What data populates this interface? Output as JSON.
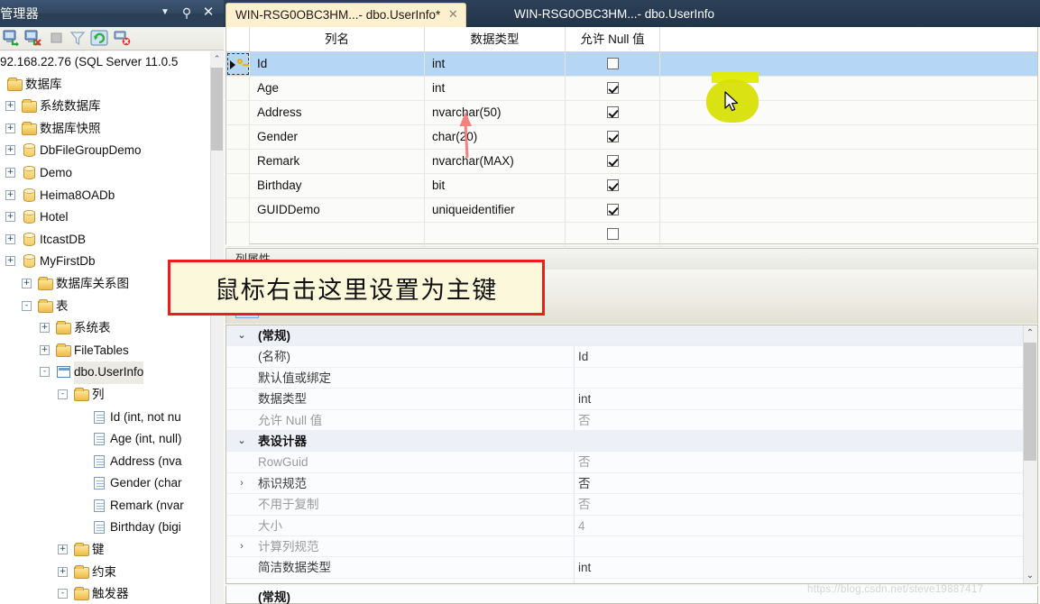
{
  "object_explorer": {
    "title": "源管理器",
    "window_buttons": {
      "dropdown": "▼",
      "pin": "⚲",
      "close": "✕"
    },
    "toolbar": [
      {
        "name": "connect-icon",
        "tooltip": "连接"
      },
      {
        "name": "disconnect-icon",
        "tooltip": "断开连接"
      },
      {
        "name": "stop-icon",
        "tooltip": "停止"
      },
      {
        "name": "filter-icon",
        "tooltip": "筛选器"
      },
      {
        "name": "refresh-icon",
        "tooltip": "刷新"
      },
      {
        "name": "disconnect-all-icon",
        "tooltip": "全部断开连接"
      }
    ],
    "tree": [
      {
        "label": "92.168.22.76 (SQL Server 11.0.5",
        "indent": 0,
        "icon": "none",
        "expander": ""
      },
      {
        "label": "数据库",
        "indent": 8,
        "icon": "folder",
        "expander": ""
      },
      {
        "label": "系统数据库",
        "indent": 24,
        "icon": "folder",
        "expander": "+"
      },
      {
        "label": "数据库快照",
        "indent": 24,
        "icon": "folder",
        "expander": "+"
      },
      {
        "label": "DbFileGroupDemo",
        "indent": 24,
        "icon": "db",
        "expander": "+"
      },
      {
        "label": "Demo",
        "indent": 24,
        "icon": "db",
        "expander": "+"
      },
      {
        "label": "Heima8OADb",
        "indent": 24,
        "icon": "db",
        "expander": "+"
      },
      {
        "label": "Hotel",
        "indent": 24,
        "icon": "db",
        "expander": "+"
      },
      {
        "label": "ItcastDB",
        "indent": 24,
        "icon": "db",
        "expander": "+"
      },
      {
        "label": "MyFirstDb",
        "indent": 24,
        "icon": "db",
        "expander": "+"
      },
      {
        "label": "数据库关系图",
        "indent": 42,
        "icon": "folder",
        "expander": "+"
      },
      {
        "label": "表",
        "indent": 42,
        "icon": "folder",
        "expander": "-"
      },
      {
        "label": "系统表",
        "indent": 62,
        "icon": "folder",
        "expander": "+"
      },
      {
        "label": "FileTables",
        "indent": 62,
        "icon": "folder",
        "expander": "+"
      },
      {
        "label": "dbo.UserInfo",
        "indent": 62,
        "icon": "table",
        "expander": "-",
        "selected": true
      },
      {
        "label": "列",
        "indent": 82,
        "icon": "folder",
        "expander": "-"
      },
      {
        "label": "Id (int, not nu",
        "indent": 102,
        "icon": "column",
        "expander": ""
      },
      {
        "label": "Age (int, null)",
        "indent": 102,
        "icon": "column",
        "expander": ""
      },
      {
        "label": "Address (nva",
        "indent": 102,
        "icon": "column",
        "expander": ""
      },
      {
        "label": "Gender (char",
        "indent": 102,
        "icon": "column",
        "expander": ""
      },
      {
        "label": "Remark (nvar",
        "indent": 102,
        "icon": "column",
        "expander": ""
      },
      {
        "label": "Birthday (bigi",
        "indent": 102,
        "icon": "column",
        "expander": ""
      },
      {
        "label": "键",
        "indent": 82,
        "icon": "folder",
        "expander": "+"
      },
      {
        "label": "约束",
        "indent": 82,
        "icon": "folder",
        "expander": "+"
      },
      {
        "label": "触发器",
        "indent": 82,
        "icon": "folder",
        "expander": "-"
      }
    ]
  },
  "tabs": [
    {
      "label": "WIN-RSG0OBC3HM...- dbo.UserInfo*",
      "active": true,
      "close": "✕"
    },
    {
      "label": "WIN-RSG0OBC3HM...- dbo.UserInfo",
      "active": false,
      "close": ""
    }
  ],
  "designer": {
    "columns": [
      "",
      "列名",
      "数据类型",
      "允许 Null 值",
      ""
    ],
    "rows": [
      {
        "name": "Id",
        "type": "int",
        "allow_null": false,
        "selected": true,
        "key": true
      },
      {
        "name": "Age",
        "type": "int",
        "allow_null": true,
        "selected": false,
        "key": false
      },
      {
        "name": "Address",
        "type": "nvarchar(50)",
        "allow_null": true,
        "selected": false,
        "key": false
      },
      {
        "name": "Gender",
        "type": "char(20)",
        "allow_null": true,
        "selected": false,
        "key": false
      },
      {
        "name": "Remark",
        "type": "nvarchar(MAX)",
        "allow_null": true,
        "selected": false,
        "key": false
      },
      {
        "name": "Birthday",
        "type": "bit",
        "allow_null": true,
        "selected": false,
        "key": false
      },
      {
        "name": "GUIDDemo",
        "type": "uniqueidentifier",
        "allow_null": true,
        "selected": false,
        "key": false
      },
      {
        "name": "",
        "type": "",
        "allow_null": false,
        "selected": false,
        "key": false
      }
    ]
  },
  "column_properties": {
    "header": "列属性",
    "toolbar": [
      {
        "name": "categorized-sort-button",
        "active": true
      },
      {
        "name": "alphabetical-sort-button",
        "active": false
      },
      {
        "name": "property-pages-button",
        "active": false
      }
    ],
    "rows": [
      {
        "expander": "⌄",
        "name": "(常规)",
        "value": "",
        "category": true,
        "dim": false,
        "value_dim": false
      },
      {
        "expander": "",
        "name": "(名称)",
        "value": "Id",
        "category": false,
        "dim": false,
        "value_dim": false
      },
      {
        "expander": "",
        "name": "默认值或绑定",
        "value": "",
        "category": false,
        "dim": false,
        "value_dim": false
      },
      {
        "expander": "",
        "name": "数据类型",
        "value": "int",
        "category": false,
        "dim": false,
        "value_dim": false
      },
      {
        "expander": "",
        "name": "允许 Null 值",
        "value": "否",
        "category": false,
        "dim": true,
        "value_dim": true
      },
      {
        "expander": "⌄",
        "name": "表设计器",
        "value": "",
        "category": true,
        "dim": false,
        "value_dim": false
      },
      {
        "expander": "",
        "name": "RowGuid",
        "value": "否",
        "category": false,
        "dim": true,
        "value_dim": true
      },
      {
        "expander": "›",
        "name": "标识规范",
        "value": "否",
        "category": false,
        "dim": false,
        "value_dim": false
      },
      {
        "expander": "",
        "name": "不用于复制",
        "value": "否",
        "category": false,
        "dim": true,
        "value_dim": true
      },
      {
        "expander": "",
        "name": "大小",
        "value": "4",
        "category": false,
        "dim": true,
        "value_dim": true
      },
      {
        "expander": "›",
        "name": "计算列规范",
        "value": "",
        "category": false,
        "dim": true,
        "value_dim": false
      },
      {
        "expander": "",
        "name": "简洁数据类型",
        "value": "int",
        "category": false,
        "dim": false,
        "value_dim": false
      }
    ],
    "footer_label": "(常规)",
    "scroll": {
      "up": "⌃",
      "down": "⌄"
    }
  },
  "annotation": {
    "callout_text": "鼠标右击这里设置为主键",
    "border_color": "#ee1c1c",
    "fill_color": "#fcf8dc",
    "arrow_color": "#f4827f"
  },
  "watermark": "https://blog.csdn.net/steve19887417",
  "colors": {
    "titlebar": "#2b4159",
    "tab_active": "#fdf0cf",
    "row_selected": "#b5d6f5",
    "cursor_highlight": "#d7e000"
  }
}
